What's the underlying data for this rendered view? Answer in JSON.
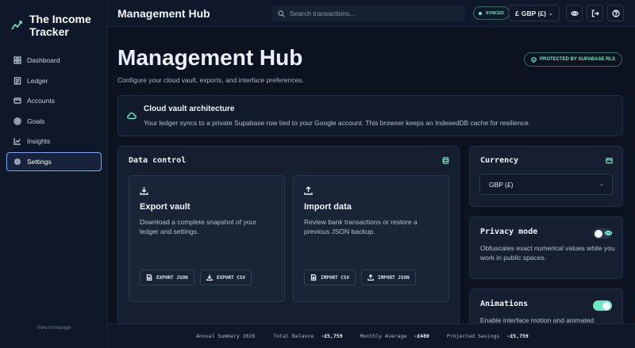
{
  "app": {
    "brand": "The Income Tracker"
  },
  "sidebar": {
    "items": [
      {
        "label": "Dashboard",
        "icon": "dashboard-icon"
      },
      {
        "label": "Ledger",
        "icon": "ledger-icon"
      },
      {
        "label": "Accounts",
        "icon": "accounts-icon"
      },
      {
        "label": "Goals",
        "icon": "target-icon"
      },
      {
        "label": "Insights",
        "icon": "chart-icon"
      },
      {
        "label": "Settings",
        "icon": "gear-icon",
        "active": true
      }
    ],
    "view_homepage": "View homepage"
  },
  "header": {
    "title": "Management Hub",
    "search_placeholder": "Search transactions...",
    "sync_status": "SYNCED",
    "currency_symbol": "£",
    "currency_label": "GBP (£)"
  },
  "page": {
    "title": "Management Hub",
    "subtitle": "Configure your cloud vault, exports, and interface preferences.",
    "badge": "PROTECTED BY SUPABASE RLS"
  },
  "info": {
    "title": "Cloud vault architecture",
    "body": "Your ledger syncs to a private Supabase row tied to your Google account. This browser keeps an IndexedDB cache for resilience."
  },
  "data_control": {
    "title": "Data control",
    "export": {
      "title": "Export vault",
      "description": "Download a complete snapshot of your ledger and settings.",
      "btn_json": "EXPORT JSON",
      "btn_csv": "EXPORT CSV"
    },
    "import": {
      "title": "Import data",
      "description": "Review bank transactions or restore a previous JSON backup.",
      "btn_csv": "IMPORT CSV",
      "btn_json": "IMPORT JSON"
    }
  },
  "currency": {
    "title": "Currency",
    "selected": "GBP (£)"
  },
  "privacy": {
    "title": "Privacy mode",
    "description": "Obfuscates exact numerical values while you work in public spaces.",
    "enabled": false
  },
  "animations": {
    "title": "Animations",
    "description": "Enable interface motion and animated",
    "enabled": true
  },
  "footer": {
    "annual_summary": "Annual Summary 2026",
    "total_balance_label": "Total Balance",
    "total_balance_value": "-£5,759",
    "monthly_average_label": "Monthly Average",
    "monthly_average_value": "-£480",
    "projected_savings_label": "Projected Savings",
    "projected_savings_value": "-£5,759"
  },
  "colors": {
    "accent": "#6ee7c5",
    "background": "#0b1220",
    "active_border": "#7aa7ff"
  }
}
